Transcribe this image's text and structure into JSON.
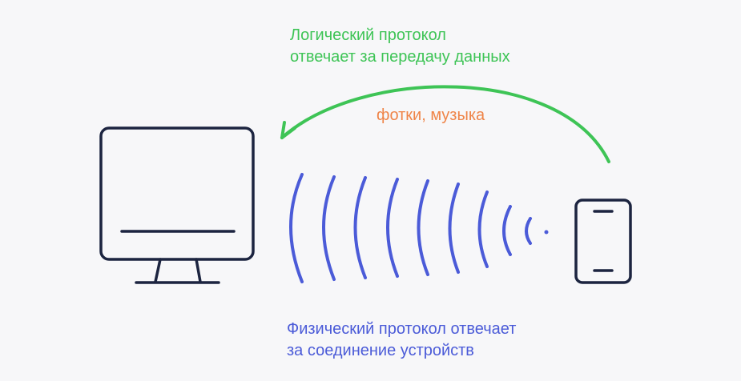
{
  "logical_protocol": {
    "line1": "Логический протокол",
    "line2": "отвечает за передачу данных",
    "color": "#3ec456"
  },
  "data_transfer": {
    "text": "фотки, музыка",
    "color": "#ef8448"
  },
  "physical_protocol": {
    "line1": "Физический протокол отвечает",
    "line2": "за соединение устройств",
    "color": "#4b5bd8"
  },
  "devices": {
    "computer_icon": "monitor-icon",
    "phone_icon": "smartphone-icon",
    "stroke_color": "#1c2440"
  },
  "signal": {
    "icon": "wireless-waves-icon",
    "color": "#4b5bd8"
  },
  "arrow": {
    "icon": "curved-arrow-icon",
    "color": "#3ec456"
  }
}
